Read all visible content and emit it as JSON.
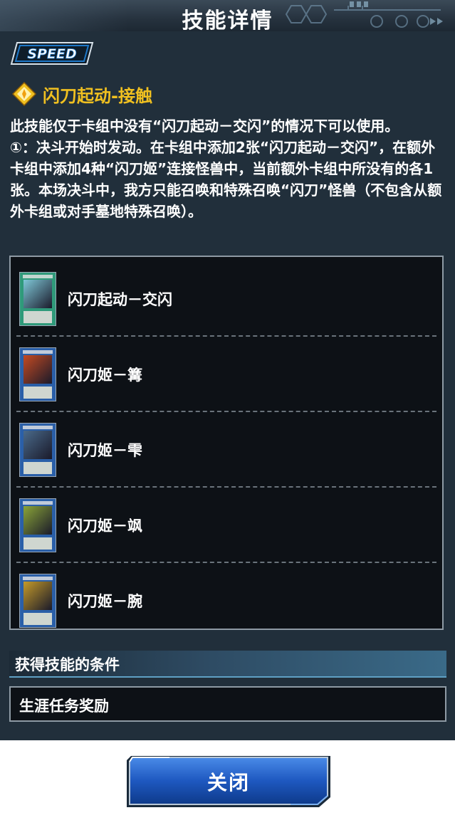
{
  "header": {
    "title": "技能详情"
  },
  "skill": {
    "logo_text": "SPEED",
    "name": "闪刀起动-接触",
    "description_lines": [
      "此技能仅于卡组中没有“闪刀起动－交闪”的情况下可以使用。",
      "①：决斗开始时发动。在卡组中添加2张“闪刀起动－交闪”，在额外卡组中添加4种“闪刀姬”连接怪兽中，当前额外卡组中所没有的各1张。本场决斗中，我方只能召唤和特殊召唤“闪刀”怪兽（不包含从额外卡组或对手墓地特殊召唤）。"
    ]
  },
  "cards": [
    {
      "name": "闪刀起动－交闪",
      "frame_color": "#2f9a7a",
      "art_color": "#7fc8d8",
      "icon": "spell-card-icon"
    },
    {
      "name": "闪刀姬－篝",
      "frame_color": "#2a5fa8",
      "art_color": "#c44a22",
      "icon": "link-monster-card-icon"
    },
    {
      "name": "闪刀姬－雫",
      "frame_color": "#2a5fa8",
      "art_color": "#4a6a8a",
      "icon": "link-monster-card-icon"
    },
    {
      "name": "闪刀姬－飒",
      "frame_color": "#2a5fa8",
      "art_color": "#8aa438",
      "icon": "link-monster-card-icon"
    },
    {
      "name": "闪刀姬－腕",
      "frame_color": "#2a5fa8",
      "art_color": "#c49a2a",
      "icon": "link-monster-card-icon"
    }
  ],
  "conditions": {
    "header": "获得技能的条件",
    "value": "生涯任务奖励"
  },
  "footer": {
    "close_label": "关闭"
  },
  "colors": {
    "panel_bg": "#212f3b",
    "skill_name": "#f0c020",
    "list_bg": "#0d1116",
    "button_blue": "#1e58c0"
  }
}
